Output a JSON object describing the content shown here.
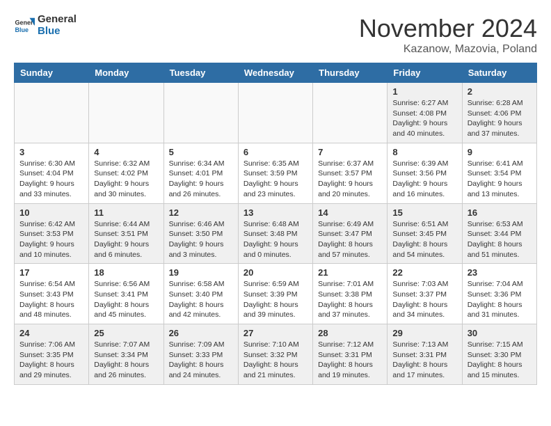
{
  "header": {
    "logo": {
      "line1": "General",
      "line2": "Blue"
    },
    "title": "November 2024",
    "subtitle": "Kazanow, Mazovia, Poland"
  },
  "weekdays": [
    "Sunday",
    "Monday",
    "Tuesday",
    "Wednesday",
    "Thursday",
    "Friday",
    "Saturday"
  ],
  "weeks": [
    [
      {
        "day": "",
        "info": ""
      },
      {
        "day": "",
        "info": ""
      },
      {
        "day": "",
        "info": ""
      },
      {
        "day": "",
        "info": ""
      },
      {
        "day": "",
        "info": ""
      },
      {
        "day": "1",
        "info": "Sunrise: 6:27 AM\nSunset: 4:08 PM\nDaylight: 9 hours\nand 40 minutes."
      },
      {
        "day": "2",
        "info": "Sunrise: 6:28 AM\nSunset: 4:06 PM\nDaylight: 9 hours\nand 37 minutes."
      }
    ],
    [
      {
        "day": "3",
        "info": "Sunrise: 6:30 AM\nSunset: 4:04 PM\nDaylight: 9 hours\nand 33 minutes."
      },
      {
        "day": "4",
        "info": "Sunrise: 6:32 AM\nSunset: 4:02 PM\nDaylight: 9 hours\nand 30 minutes."
      },
      {
        "day": "5",
        "info": "Sunrise: 6:34 AM\nSunset: 4:01 PM\nDaylight: 9 hours\nand 26 minutes."
      },
      {
        "day": "6",
        "info": "Sunrise: 6:35 AM\nSunset: 3:59 PM\nDaylight: 9 hours\nand 23 minutes."
      },
      {
        "day": "7",
        "info": "Sunrise: 6:37 AM\nSunset: 3:57 PM\nDaylight: 9 hours\nand 20 minutes."
      },
      {
        "day": "8",
        "info": "Sunrise: 6:39 AM\nSunset: 3:56 PM\nDaylight: 9 hours\nand 16 minutes."
      },
      {
        "day": "9",
        "info": "Sunrise: 6:41 AM\nSunset: 3:54 PM\nDaylight: 9 hours\nand 13 minutes."
      }
    ],
    [
      {
        "day": "10",
        "info": "Sunrise: 6:42 AM\nSunset: 3:53 PM\nDaylight: 9 hours\nand 10 minutes."
      },
      {
        "day": "11",
        "info": "Sunrise: 6:44 AM\nSunset: 3:51 PM\nDaylight: 9 hours\nand 6 minutes."
      },
      {
        "day": "12",
        "info": "Sunrise: 6:46 AM\nSunset: 3:50 PM\nDaylight: 9 hours\nand 3 minutes."
      },
      {
        "day": "13",
        "info": "Sunrise: 6:48 AM\nSunset: 3:48 PM\nDaylight: 9 hours\nand 0 minutes."
      },
      {
        "day": "14",
        "info": "Sunrise: 6:49 AM\nSunset: 3:47 PM\nDaylight: 8 hours\nand 57 minutes."
      },
      {
        "day": "15",
        "info": "Sunrise: 6:51 AM\nSunset: 3:45 PM\nDaylight: 8 hours\nand 54 minutes."
      },
      {
        "day": "16",
        "info": "Sunrise: 6:53 AM\nSunset: 3:44 PM\nDaylight: 8 hours\nand 51 minutes."
      }
    ],
    [
      {
        "day": "17",
        "info": "Sunrise: 6:54 AM\nSunset: 3:43 PM\nDaylight: 8 hours\nand 48 minutes."
      },
      {
        "day": "18",
        "info": "Sunrise: 6:56 AM\nSunset: 3:41 PM\nDaylight: 8 hours\nand 45 minutes."
      },
      {
        "day": "19",
        "info": "Sunrise: 6:58 AM\nSunset: 3:40 PM\nDaylight: 8 hours\nand 42 minutes."
      },
      {
        "day": "20",
        "info": "Sunrise: 6:59 AM\nSunset: 3:39 PM\nDaylight: 8 hours\nand 39 minutes."
      },
      {
        "day": "21",
        "info": "Sunrise: 7:01 AM\nSunset: 3:38 PM\nDaylight: 8 hours\nand 37 minutes."
      },
      {
        "day": "22",
        "info": "Sunrise: 7:03 AM\nSunset: 3:37 PM\nDaylight: 8 hours\nand 34 minutes."
      },
      {
        "day": "23",
        "info": "Sunrise: 7:04 AM\nSunset: 3:36 PM\nDaylight: 8 hours\nand 31 minutes."
      }
    ],
    [
      {
        "day": "24",
        "info": "Sunrise: 7:06 AM\nSunset: 3:35 PM\nDaylight: 8 hours\nand 29 minutes."
      },
      {
        "day": "25",
        "info": "Sunrise: 7:07 AM\nSunset: 3:34 PM\nDaylight: 8 hours\nand 26 minutes."
      },
      {
        "day": "26",
        "info": "Sunrise: 7:09 AM\nSunset: 3:33 PM\nDaylight: 8 hours\nand 24 minutes."
      },
      {
        "day": "27",
        "info": "Sunrise: 7:10 AM\nSunset: 3:32 PM\nDaylight: 8 hours\nand 21 minutes."
      },
      {
        "day": "28",
        "info": "Sunrise: 7:12 AM\nSunset: 3:31 PM\nDaylight: 8 hours\nand 19 minutes."
      },
      {
        "day": "29",
        "info": "Sunrise: 7:13 AM\nSunset: 3:31 PM\nDaylight: 8 hours\nand 17 minutes."
      },
      {
        "day": "30",
        "info": "Sunrise: 7:15 AM\nSunset: 3:30 PM\nDaylight: 8 hours\nand 15 minutes."
      }
    ]
  ]
}
